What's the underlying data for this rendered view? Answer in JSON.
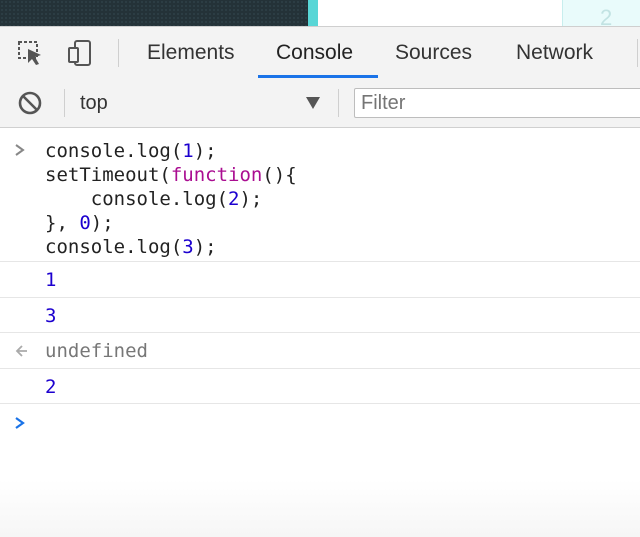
{
  "page_behind": {
    "partial_number": "2"
  },
  "toolbar": {
    "inspect_icon": "element-picker-icon",
    "device_icon": "device-toggle-icon",
    "tabs": [
      "Elements",
      "Console",
      "Sources",
      "Network"
    ],
    "active_tab": "Console"
  },
  "filterbar": {
    "clear_icon": "clear-console-icon",
    "context": "top",
    "filter_placeholder": "Filter"
  },
  "console": {
    "input_lines": [
      "console.log(1);",
      "setTimeout(function(){",
      "    console.log(2);",
      "}, 0);",
      "console.log(3);"
    ],
    "outputs": [
      {
        "kind": "log",
        "text": "1"
      },
      {
        "kind": "log",
        "text": "3"
      },
      {
        "kind": "return",
        "text": "undefined"
      },
      {
        "kind": "log",
        "text": "2"
      }
    ],
    "prompt_symbol": ">"
  },
  "colors": {
    "accent": "#1a73e8",
    "number": "#1c00cf",
    "keyword": "#aa0d91"
  }
}
